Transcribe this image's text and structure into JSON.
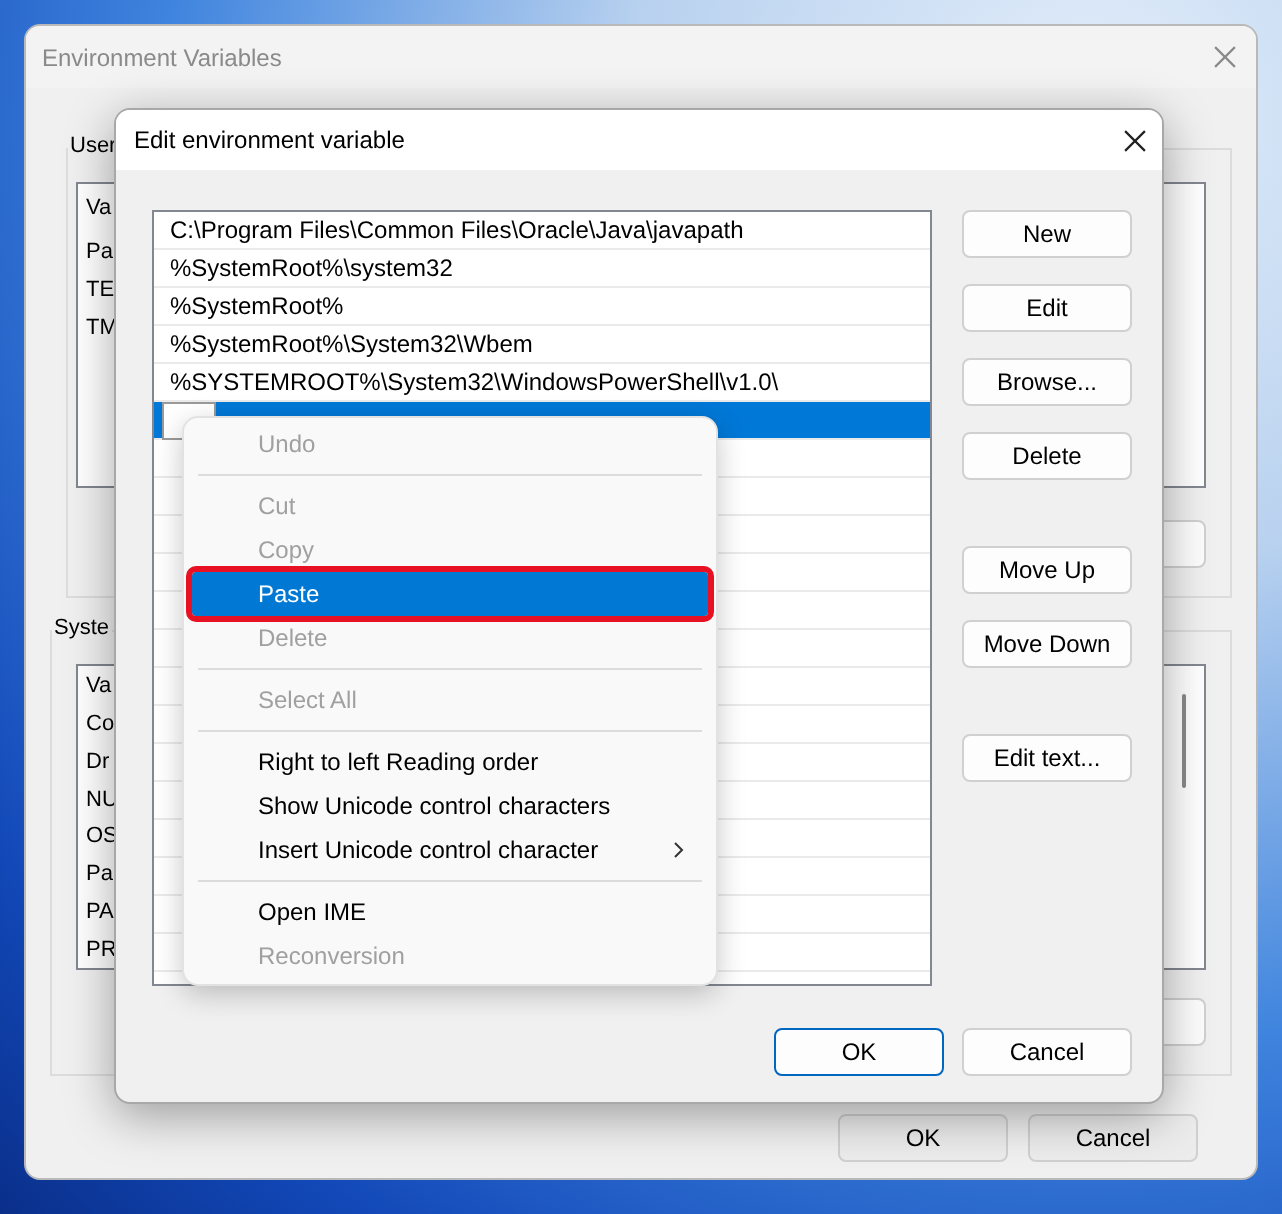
{
  "background_window": {
    "title": "Environment Variables",
    "user_group": {
      "label": "User",
      "header": "Va",
      "rows": [
        "Pa",
        "TE",
        "TM"
      ]
    },
    "system_group": {
      "label": "Syste",
      "header": "Va",
      "rows": [
        "Co",
        "Dr",
        "NU",
        "OS",
        "Pa",
        "PA",
        "PR"
      ]
    },
    "buttons": [
      "OK",
      "Cancel"
    ]
  },
  "dialog": {
    "title": "Edit environment variable",
    "entries": [
      {
        "kind": "text",
        "value": "C:\\Program Files\\Common Files\\Oracle\\Java\\javapath",
        "selected": false
      },
      {
        "kind": "text",
        "value": "%SystemRoot%\\system32",
        "selected": false
      },
      {
        "kind": "text",
        "value": "%SystemRoot%",
        "selected": false
      },
      {
        "kind": "text",
        "value": "%SystemRoot%\\System32\\Wbem",
        "selected": false
      },
      {
        "kind": "text",
        "value": "%SYSTEMROOT%\\System32\\WindowsPowerShell\\v1.0\\",
        "selected": false
      },
      {
        "kind": "edit",
        "selected": true
      }
    ],
    "button_groups": [
      [
        "New",
        "Edit",
        "Browse...",
        "Delete"
      ],
      [
        "Move Up",
        "Move Down"
      ],
      [
        "Edit text..."
      ]
    ],
    "footer_buttons": [
      {
        "label": "OK",
        "default": true
      },
      {
        "label": "Cancel",
        "default": false
      }
    ]
  },
  "context_menu": {
    "items": [
      {
        "kind": "item",
        "label": "Undo",
        "disabled": true,
        "selected": false,
        "outlined": false,
        "submenu": false
      },
      {
        "kind": "separator"
      },
      {
        "kind": "item",
        "label": "Cut",
        "disabled": true,
        "selected": false,
        "outlined": false,
        "submenu": false
      },
      {
        "kind": "item",
        "label": "Copy",
        "disabled": true,
        "selected": false,
        "outlined": false,
        "submenu": false
      },
      {
        "kind": "item",
        "label": "Paste",
        "disabled": false,
        "selected": true,
        "outlined": true,
        "submenu": false
      },
      {
        "kind": "item",
        "label": "Delete",
        "disabled": true,
        "selected": false,
        "outlined": false,
        "submenu": false
      },
      {
        "kind": "separator"
      },
      {
        "kind": "item",
        "label": "Select All",
        "disabled": true,
        "selected": false,
        "outlined": false,
        "submenu": false
      },
      {
        "kind": "separator"
      },
      {
        "kind": "item",
        "label": "Right to left Reading order",
        "disabled": false,
        "selected": false,
        "outlined": false,
        "submenu": false
      },
      {
        "kind": "item",
        "label": "Show Unicode control characters",
        "disabled": false,
        "selected": false,
        "outlined": false,
        "submenu": false
      },
      {
        "kind": "item",
        "label": "Insert Unicode control character",
        "disabled": false,
        "selected": false,
        "outlined": false,
        "submenu": true
      },
      {
        "kind": "separator"
      },
      {
        "kind": "item",
        "label": "Open IME",
        "disabled": false,
        "selected": false,
        "outlined": false,
        "submenu": false
      },
      {
        "kind": "item",
        "label": "Reconversion",
        "disabled": true,
        "selected": false,
        "outlined": false,
        "submenu": false
      }
    ]
  }
}
